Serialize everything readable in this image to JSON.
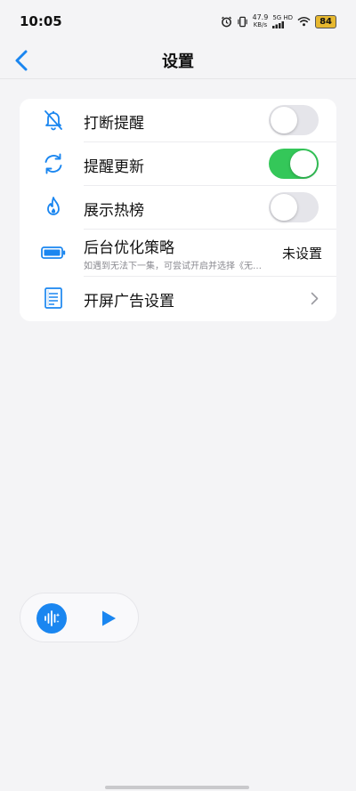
{
  "status_bar": {
    "time": "10:05",
    "speed_value": "47.9",
    "speed_unit": "KB/s",
    "network": "5G HD",
    "battery": "84"
  },
  "header": {
    "title": "设置"
  },
  "settings": {
    "interrupt_reminder": {
      "label": "打断提醒",
      "toggle_on": false
    },
    "reminder_update": {
      "label": "提醒更新",
      "toggle_on": true
    },
    "show_hot_list": {
      "label": "展示热榜",
      "toggle_on": false
    },
    "background_optimization": {
      "label": "后台优化策略",
      "subtitle": "如遇到无法下一集，可尝试开启并选择《无…",
      "value": "未设置"
    },
    "splash_ad": {
      "label": "开屏广告设置"
    }
  },
  "colors": {
    "accent": "#1a86f0",
    "toggle_on": "#34c759",
    "toggle_off": "#e5e5ea",
    "background": "#f4f4f6"
  }
}
